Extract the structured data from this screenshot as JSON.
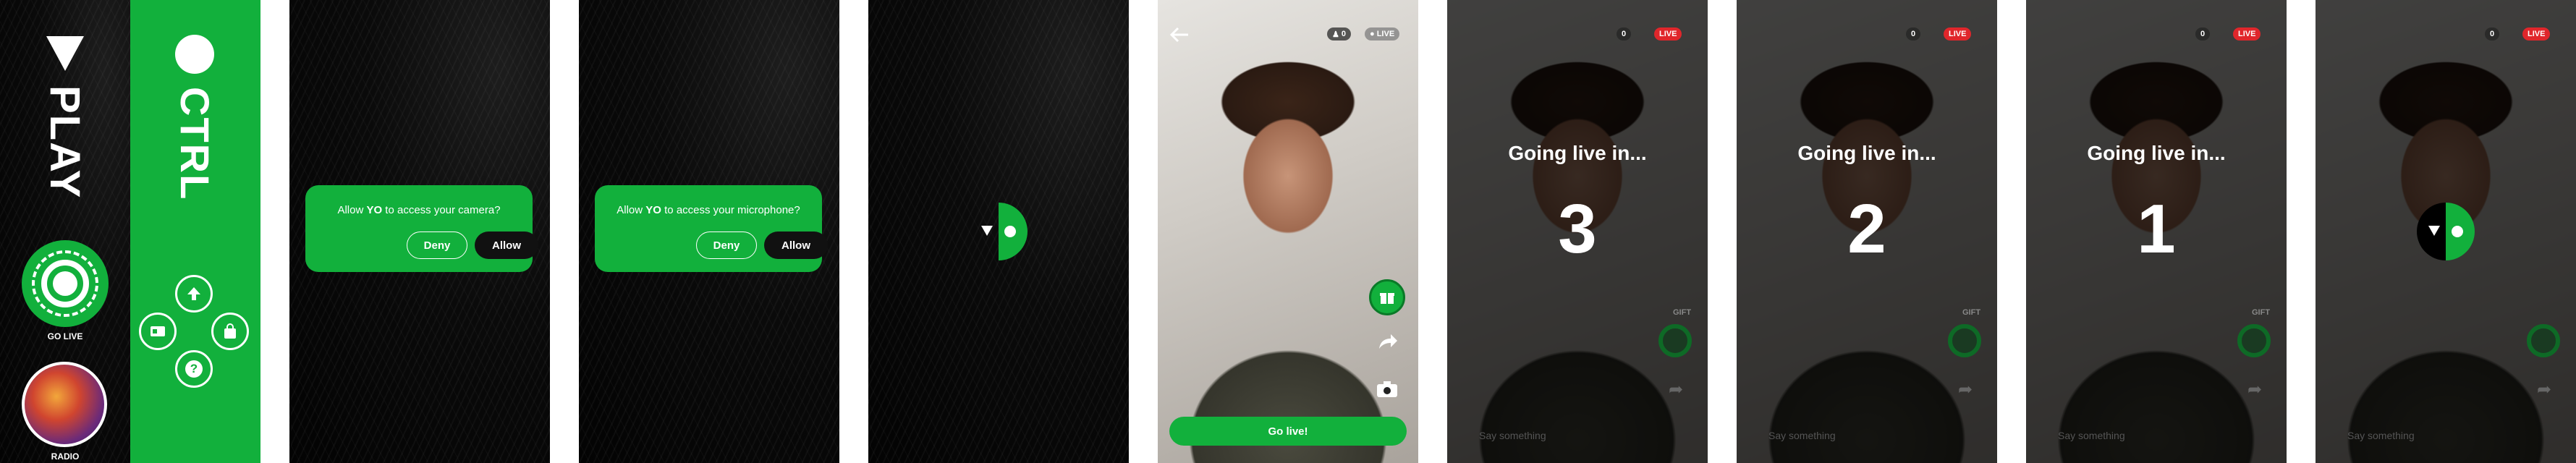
{
  "splash": {
    "play_label": "PLAY",
    "go_live_label": "GO LIVE",
    "radio_label": "RADIO"
  },
  "ctrl": {
    "label": "CTRL"
  },
  "camera_prompt": {
    "prefix": "Allow ",
    "app": "YO",
    "suffix": " to access your camera?",
    "deny": "Deny",
    "allow": "Allow"
  },
  "mic_prompt": {
    "prefix": "Allow ",
    "app": "YO",
    "suffix": " to access your microphone?",
    "deny": "Deny",
    "allow": "Allow"
  },
  "camera_view": {
    "viewer_count": "0",
    "live_label": "LIVE",
    "go_live_button": "Go live!"
  },
  "countdown": {
    "heading": "Going live in...",
    "steps": [
      "3",
      "2",
      "1"
    ],
    "viewer_count": "0",
    "live_label": "LIVE",
    "side_label": "GIFT",
    "comment_placeholder": "Say something"
  },
  "colors": {
    "brand_green": "#12b03c",
    "live_red": "#e0262b",
    "black": "#000000"
  }
}
